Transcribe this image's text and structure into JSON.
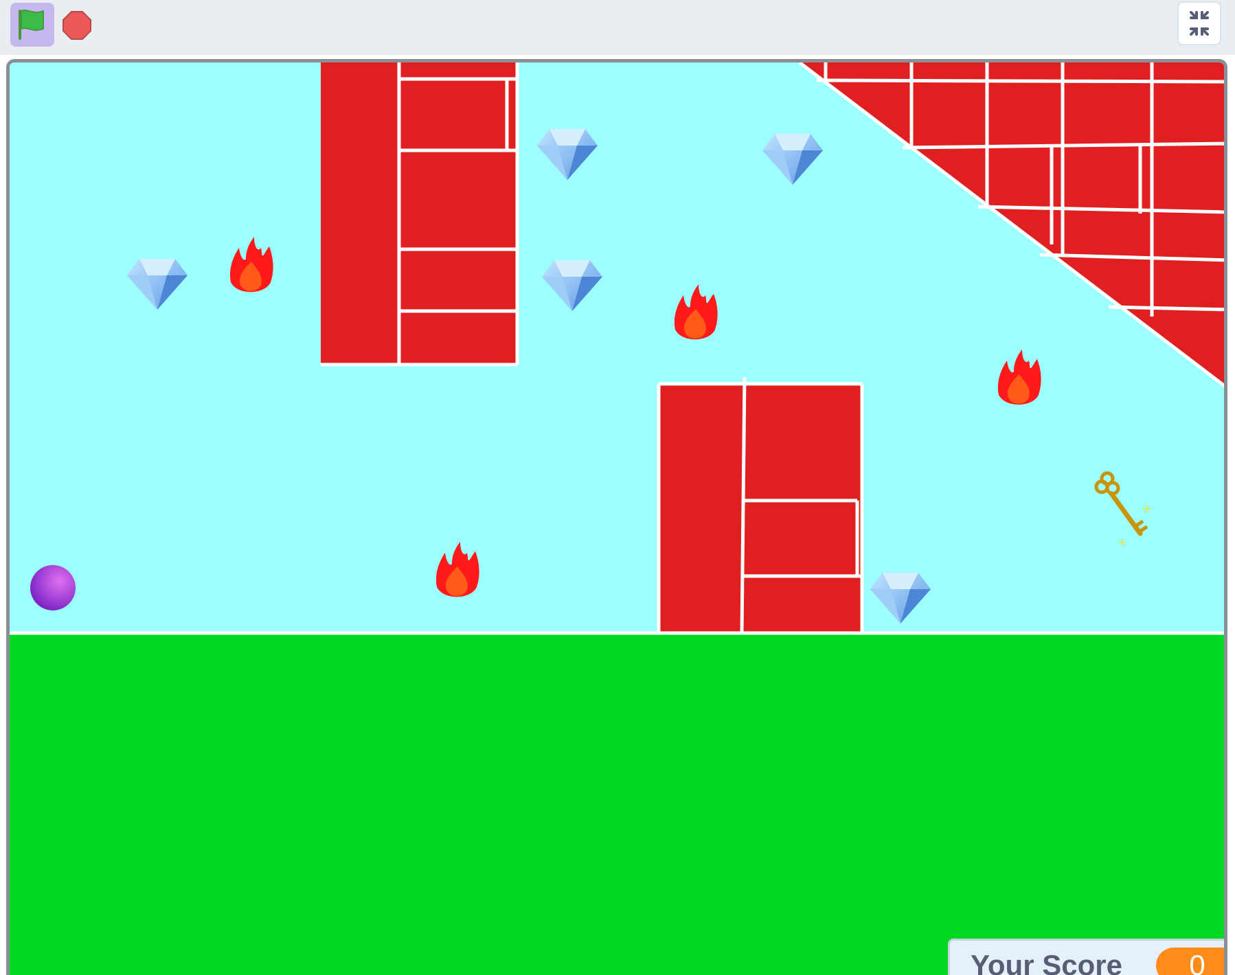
{
  "toolbar": {
    "green_flag_icon": "green-flag-icon",
    "stop_icon": "stop-icon",
    "exit_fullscreen_icon": "exit-fullscreen-icon",
    "flag_color": "#3dbb4a",
    "stop_color": "#ec5959"
  },
  "stage": {
    "sky_color": "#9cfffd",
    "ground_color": "#00d924",
    "brick_color": "#e02020",
    "sprites": [
      "ball",
      "gem",
      "fire",
      "key",
      "brick-wall"
    ]
  },
  "score_monitor": {
    "label": "Your Score",
    "value": "0",
    "value_color": "#ff8c1a"
  }
}
